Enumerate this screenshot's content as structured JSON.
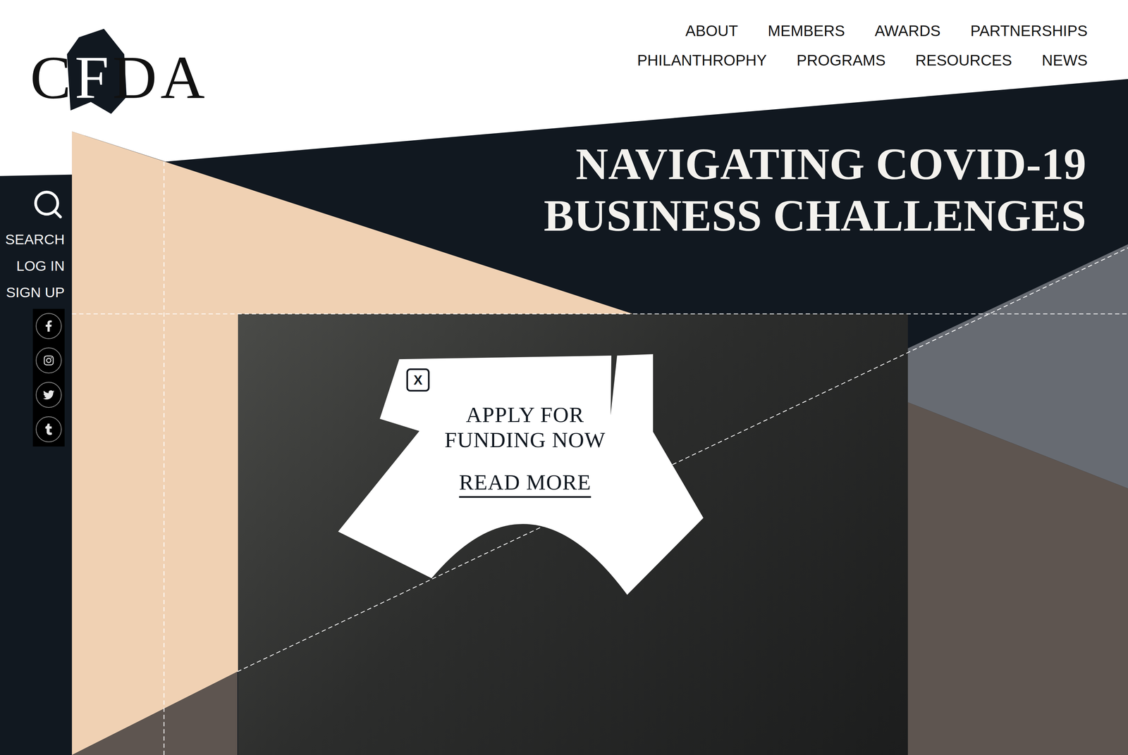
{
  "logo": {
    "parts": [
      {
        "text": "C",
        "inverted": false
      },
      {
        "text": "F",
        "inverted": true
      },
      {
        "text": "DA",
        "inverted": false
      }
    ]
  },
  "nav": {
    "rows": [
      [
        "ABOUT",
        "MEMBERS",
        "AWARDS",
        "PARTNERSHIPS"
      ],
      [
        "PHILANTHROPHY",
        "PROGRAMS",
        "RESOURCES",
        "NEWS"
      ]
    ]
  },
  "sidebar": {
    "items": [
      "SEARCH",
      "LOG IN",
      "SIGN UP"
    ]
  },
  "hero": {
    "title_lines": [
      "NAVIGATING COVID-19",
      "BUSINESS CHALLENGES"
    ]
  },
  "popup": {
    "close": "X",
    "title_lines": [
      "APPLY FOR",
      "FUNDING NOW"
    ],
    "link": "READ MORE"
  }
}
